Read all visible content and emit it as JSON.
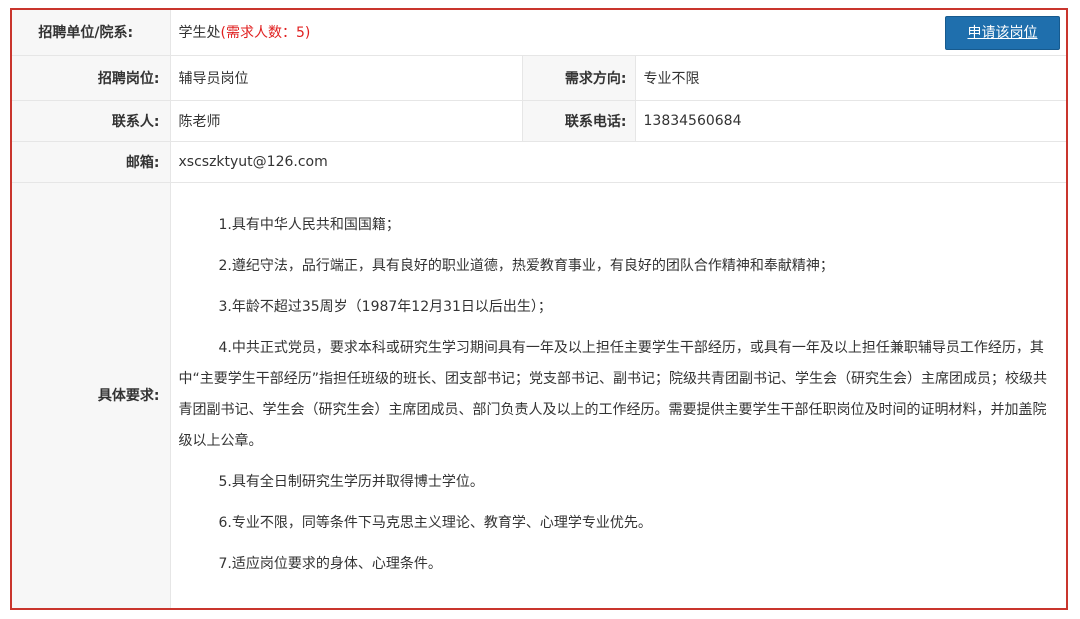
{
  "unit": {
    "label": "招聘单位/院系:",
    "value": "学生处",
    "demand": "(需求人数：5)"
  },
  "apply_button": "申请该岗位",
  "position": {
    "label": "招聘岗位:",
    "value": "辅导员岗位"
  },
  "direction": {
    "label": "需求方向:",
    "value": "专业不限"
  },
  "contact": {
    "label": "联系人:",
    "value": "陈老师"
  },
  "phone": {
    "label": "联系电话:",
    "value": "13834560684"
  },
  "email": {
    "label": "邮箱:",
    "value": "xscszktyut@126.com"
  },
  "requirements": {
    "label": "具体要求:",
    "items": [
      "1.具有中华人民共和国国籍；",
      "2.遵纪守法，品行端正，具有良好的职业道德，热爱教育事业，有良好的团队合作精神和奉献精神；",
      "3.年龄不超过35周岁（1987年12月31日以后出生）；",
      "4.中共正式党员，要求本科或研究生学习期间具有一年及以上担任主要学生干部经历，或具有一年及以上担任兼职辅导员工作经历，其中“主要学生干部经历”指担任班级的班长、团支部书记；党支部书记、副书记；院级共青团副书记、学生会（研究生会）主席团成员；校级共青团副书记、学生会（研究生会）主席团成员、部门负责人及以上的工作经历。需要提供主要学生干部任职岗位及时间的证明材料，并加盖院级以上公章。",
      "5.具有全日制研究生学历并取得博士学位。",
      "6.专业不限，同等条件下马克思主义理论、教育学、心理学专业优先。",
      "7.适应岗位要求的身体、心理条件。"
    ]
  },
  "colors": {
    "frame_border": "#c9352d",
    "demand_text": "#e02020",
    "button_bg": "#1f6fad",
    "label_bg": "#f7f7f7"
  }
}
